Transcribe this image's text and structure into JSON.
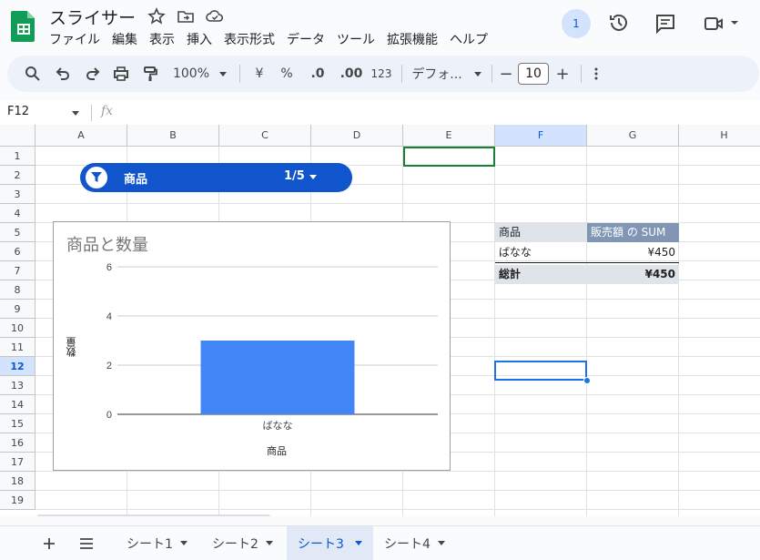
{
  "document": {
    "title": "スライサー",
    "menu": [
      "ファイル",
      "編集",
      "表示",
      "挿入",
      "表示形式",
      "データ",
      "ツール",
      "拡張機能",
      "ヘルプ"
    ],
    "avatar_count": "1"
  },
  "toolbar": {
    "zoom": "100%",
    "currency": "¥",
    "percent": "%",
    "decrease_decimal": ".0",
    "increase_decimal": ".00",
    "number_format": "123",
    "font_name": "デフォ...",
    "font_size": "10",
    "minus": "−",
    "plus": "+"
  },
  "formula_bar": {
    "cell_ref": "F12",
    "fx": "fx",
    "value": ""
  },
  "grid": {
    "columns": [
      "A",
      "B",
      "C",
      "D",
      "E",
      "F",
      "G",
      "H"
    ],
    "rows": [
      "1",
      "2",
      "3",
      "4",
      "5",
      "6",
      "7",
      "8",
      "9",
      "10",
      "11",
      "12",
      "13",
      "14",
      "15",
      "16",
      "17",
      "18",
      "19"
    ],
    "selected_cell": "F12"
  },
  "slicer": {
    "label": "商品",
    "count": "1/5"
  },
  "chart": {
    "title": "商品と数量",
    "xlabel": "商品",
    "ylabel": "数量"
  },
  "chart_data": {
    "type": "bar",
    "title": "商品と数量",
    "xlabel": "商品",
    "ylabel": "数量",
    "categories": [
      "ばなな"
    ],
    "series": [
      {
        "values": [
          3
        ]
      }
    ],
    "yticks": [
      "0",
      "2",
      "4",
      "6"
    ],
    "ylim": [
      0,
      6
    ],
    "grid": true,
    "bar_color": "#4285f4"
  },
  "pivot": {
    "header_item": "商品",
    "header_value": "販売額 の SUM",
    "rows": [
      {
        "item": "ばなな",
        "value": "¥450"
      }
    ],
    "total_label": "総計",
    "total_value": "¥450"
  },
  "tabs": [
    {
      "label": "シート1",
      "active": false
    },
    {
      "label": "シート2",
      "active": false
    },
    {
      "label": "シート3",
      "active": true
    },
    {
      "label": "シート4",
      "active": false
    }
  ],
  "colors": {
    "accent": "#0b57d0",
    "slicer": "#1155cc",
    "pivot_header": "#8096b4",
    "pivot_header_light": "#dfe4ea"
  }
}
